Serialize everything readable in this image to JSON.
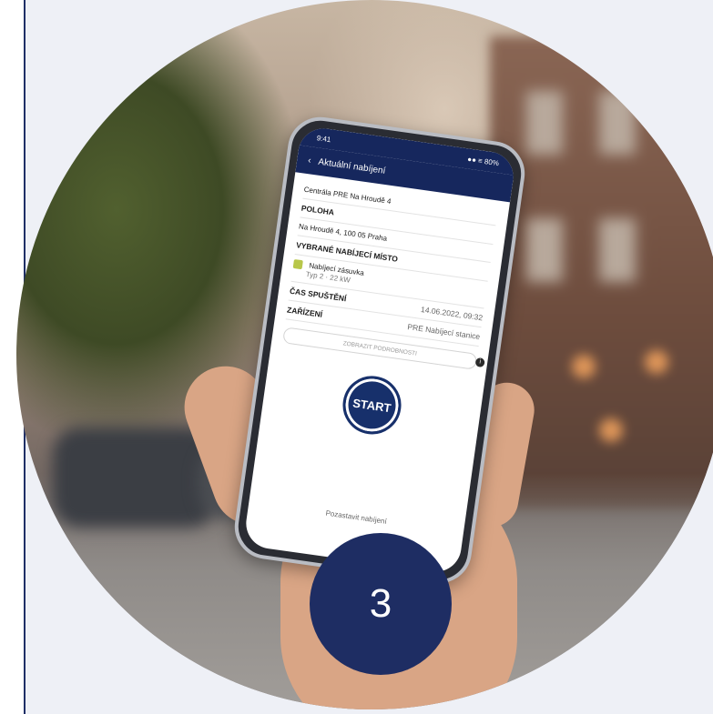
{
  "photo": {
    "phone_app": {
      "status_time": "9:41",
      "status_icons": "●● ≡ 80%",
      "header_title": "Aktuální nabíjení",
      "station_name": "Centrála PRE Na Hroudě 4",
      "location_label": "POLOHA",
      "address": "Na Hroudě 4, 100 05 Praha",
      "select_point_label": "VYBRANÉ NABÍJECÍ MÍSTO",
      "point_name": "Nabíjecí zásuvka",
      "point_detail": "Typ 2 · 22 kW",
      "start_time_label": "ČAS SPUŠTĚNÍ",
      "start_time_value": "14.06.2022, 09:32",
      "device_label": "ZAŘÍZENÍ",
      "device_value": "PRE Nabíjecí stanice",
      "pill_text": "ZOBRAZIT PODROBNOSTI",
      "info_icon_glyph": "i",
      "start_label": "START",
      "footer_link": "Pozastavit nabíjení"
    },
    "accent_color": "#1e2d63"
  },
  "step_badge": {
    "number": "3"
  }
}
